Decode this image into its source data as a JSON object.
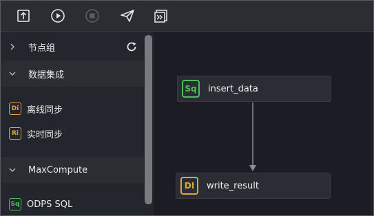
{
  "toolbar": {
    "buttons": [
      {
        "name": "upload-icon"
      },
      {
        "name": "play-icon"
      },
      {
        "name": "stop-icon",
        "disabled": true
      },
      {
        "name": "send-icon"
      },
      {
        "name": "format-icon"
      }
    ]
  },
  "sidebar": {
    "groups": [
      {
        "label": "节点组"
      },
      {
        "label": "数据集成"
      },
      {
        "label": "MaxCompute"
      }
    ],
    "items": [
      {
        "badge": "Di",
        "label": "离线同步"
      },
      {
        "badge": "Ri",
        "label": "实时同步"
      },
      {
        "badge": "Sq",
        "label": "ODPS SQL"
      }
    ]
  },
  "canvas": {
    "nodes": [
      {
        "badge": "Sq",
        "label": "insert_data"
      },
      {
        "badge": "DI",
        "label": "write_result"
      }
    ]
  },
  "colors": {
    "accent_green": "#4cbf5c",
    "accent_orange": "#e8a23a"
  }
}
